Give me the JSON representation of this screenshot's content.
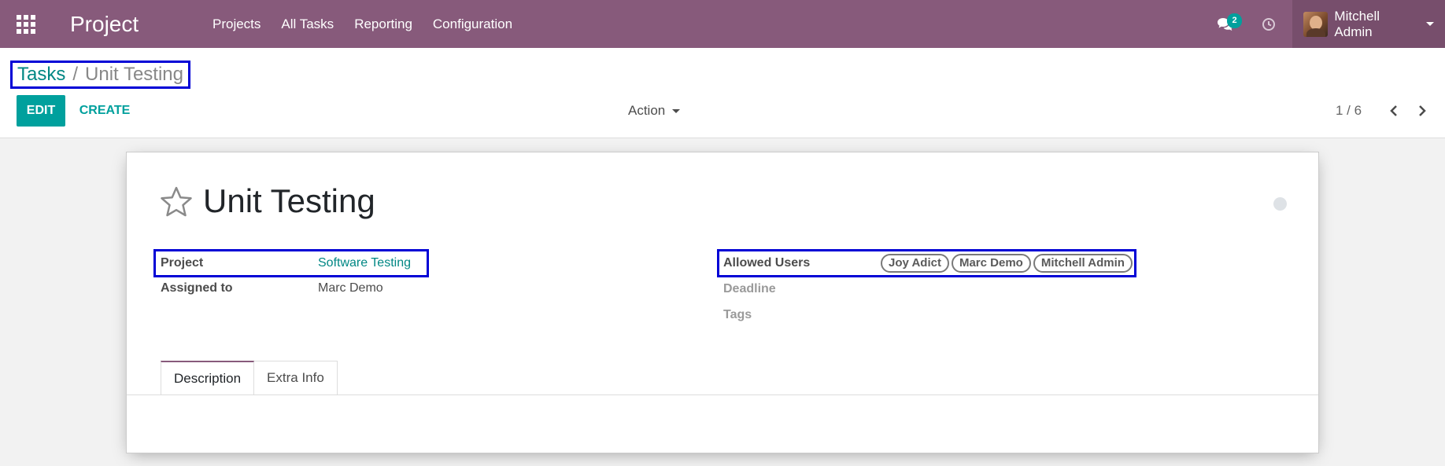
{
  "navbar": {
    "app_title": "Project",
    "menu": [
      "Projects",
      "All Tasks",
      "Reporting",
      "Configuration"
    ],
    "message_count": "2",
    "user_name": "Mitchell Admin",
    "icons": {
      "apps": "apps-grid-icon",
      "chat": "chat-icon",
      "activity": "clock-icon"
    }
  },
  "breadcrumb": {
    "parent": "Tasks",
    "separator": "/",
    "current": "Unit Testing"
  },
  "toolbar": {
    "edit_label": "EDIT",
    "create_label": "CREATE",
    "action_label": "Action",
    "pager": "1 / 6"
  },
  "task": {
    "title": "Unit Testing",
    "fields": {
      "project_label": "Project",
      "project_value": "Software Testing",
      "assigned_label": "Assigned to",
      "assigned_value": "Marc Demo",
      "allowed_users_label": "Allowed Users",
      "allowed_users": [
        "Joy Adict",
        "Marc Demo",
        "Mitchell Admin"
      ],
      "deadline_label": "Deadline",
      "tags_label": "Tags"
    },
    "tabs": [
      "Description",
      "Extra Info"
    ]
  },
  "colors": {
    "navbar": "#875a7b",
    "accent": "#00a09d",
    "link": "#008784",
    "highlight_box": "#0000d6"
  }
}
